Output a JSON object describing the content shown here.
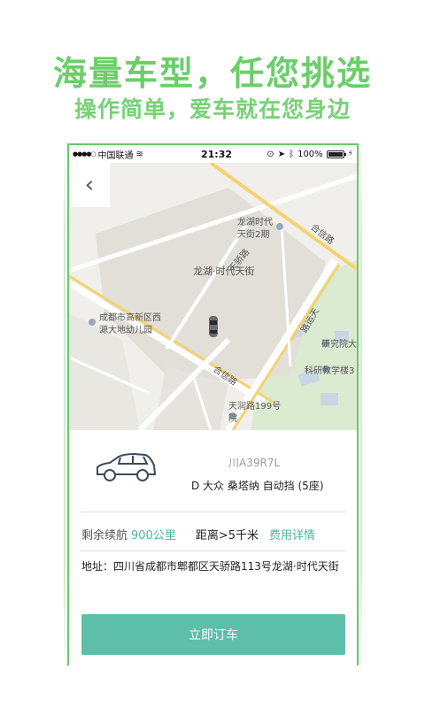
{
  "promo": {
    "title": "海量车型，任您挑选",
    "subtitle": "操作简单，爱车就在您身边"
  },
  "status_bar": {
    "signal": "●●●●○",
    "carrier": "中国联通",
    "wifi": "≋",
    "time": "21:32",
    "battery_text": "100%"
  },
  "map": {
    "labels": {
      "poi_top": "龙湖时代",
      "poi_top2": "天街2期",
      "road_tianjiao": "天骄路",
      "road_hexin_top": "合信路",
      "complex": "龙湖·时代天街",
      "kindergarten1": "成都市高新区西",
      "kindergarten2": "源大地幼儿园",
      "road_yuntong": "路运天",
      "research1": "研究院大",
      "research2": "科研教学楼3",
      "road_hexin_bottom": "合信路",
      "courtyard1": "天润路199号",
      "courtyard2": "院"
    }
  },
  "car": {
    "plate": "川A39R7L",
    "model": "D 大众 桑塔纳 自动挡 (5座)",
    "range_label": "剩余续航",
    "range_value": "900公里",
    "distance": "距离>5千米",
    "fee_link": "费用详情",
    "address": "地址：四川省成都市郫都区天骄路113号龙湖·时代天街",
    "order_button": "立即订车"
  }
}
